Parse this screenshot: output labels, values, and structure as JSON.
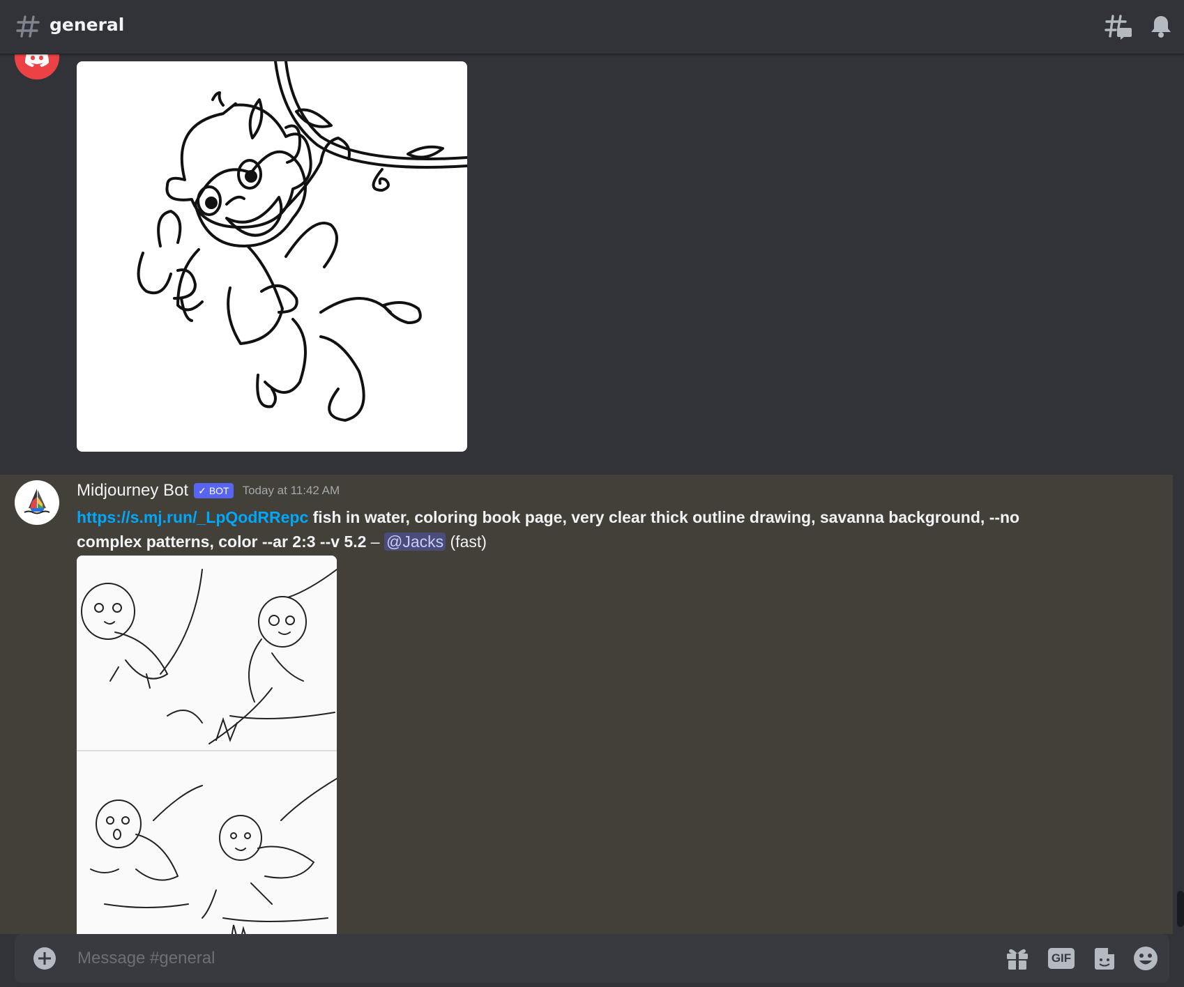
{
  "header": {
    "channel_name": "general",
    "icons": [
      "hash-icon",
      "threads-icon",
      "bell-icon"
    ]
  },
  "messages": [
    {
      "avatar_icon": "discord-logo-icon",
      "avatar_color": "#ed4245",
      "image_alt": "monkey swinging on a vine holding a banana, line art"
    },
    {
      "author": "Midjourney Bot",
      "badge": "BOT",
      "badge_color": "#5865f2",
      "timestamp": "Today at 11:42 AM",
      "link": "https://s.mj.run/_LpQodRRepc",
      "prompt": "fish in water, coloring book page, very clear thick outline drawing, savanna background, --no complex patterns, color --ar 2:3 --v 5.2",
      "separator": " – ",
      "mention": "@Jacks",
      "mode": "(fast)",
      "image_alt": "2x2 grid of monkey-fish creatures in water, line art"
    }
  ],
  "composer": {
    "placeholder": "Message #general",
    "gif_label": "GIF",
    "icons": [
      "plus-icon",
      "gift-icon",
      "sticker-icon",
      "emoji-icon"
    ]
  },
  "colors": {
    "background": "#313338",
    "highlight_row": "#433f39",
    "link": "#00a8fc",
    "composer": "#383a40"
  }
}
